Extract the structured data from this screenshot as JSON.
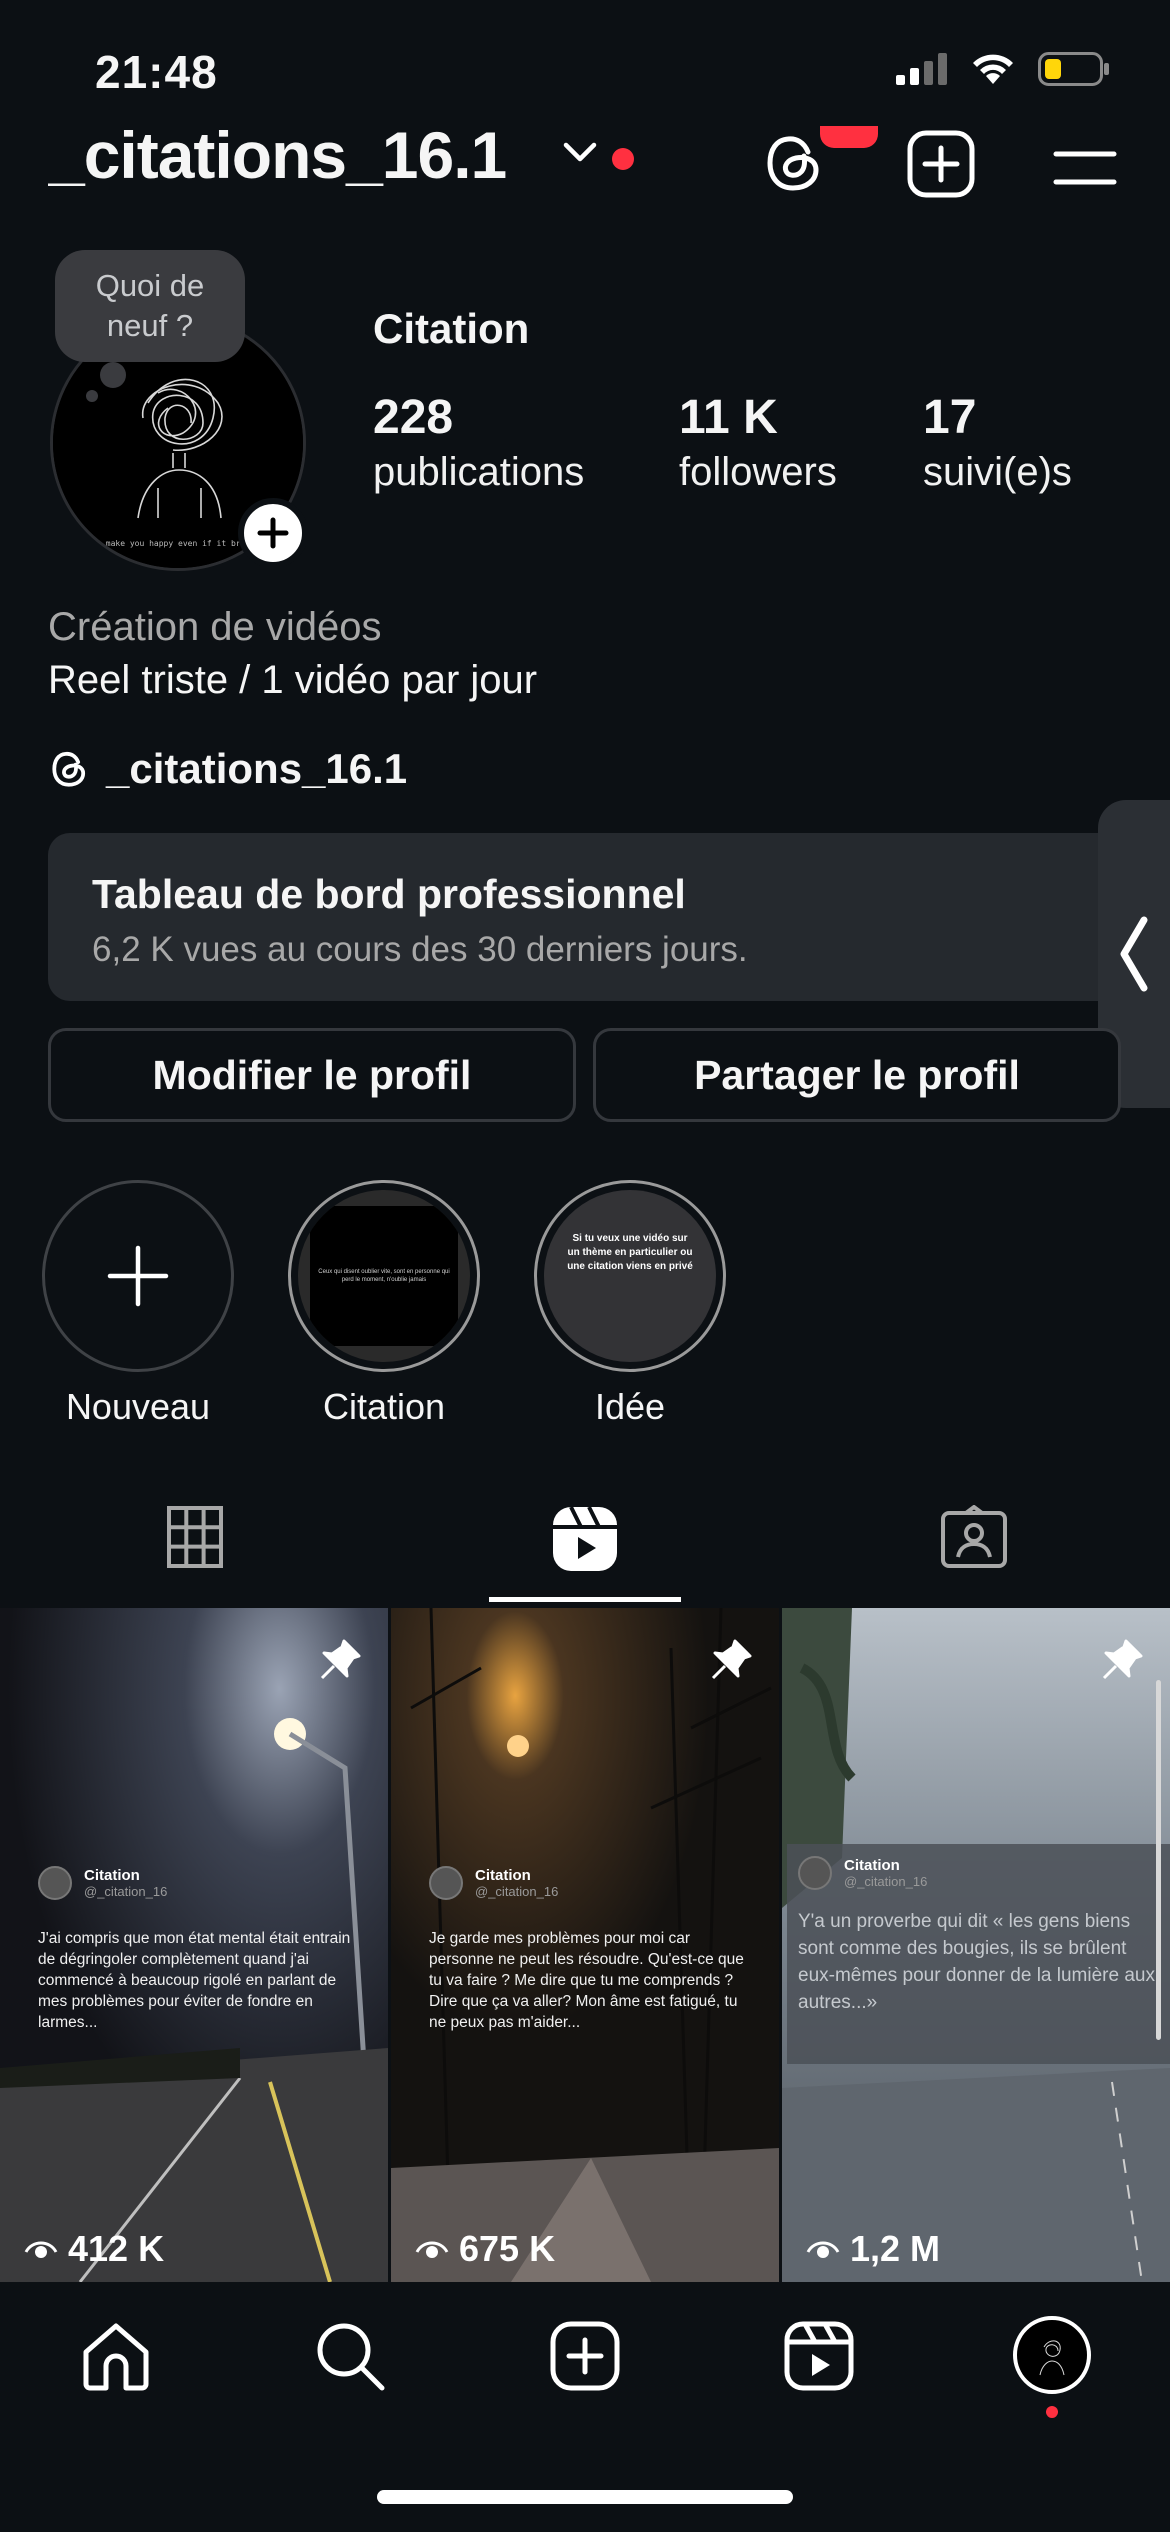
{
  "status_bar": {
    "time": "21:48"
  },
  "header": {
    "username": "_citations_16.1"
  },
  "profile": {
    "note": "Quoi de neuf ?",
    "display_name": "Citation",
    "stats": {
      "posts": {
        "value": "228",
        "label": "publications"
      },
      "followers": {
        "value": "11 K",
        "label": "followers"
      },
      "following": {
        "value": "17",
        "label": "suivi(e)s"
      }
    },
    "category": "Création de vidéos",
    "bio": "Reel triste / 1 vidéo par jour",
    "threads_handle": "_citations_16.1",
    "avatar_caption": "I'll make you happy even if it breaks me"
  },
  "dashboard": {
    "title": "Tableau de bord professionnel",
    "subtitle": "6,2 K vues au cours des 30 derniers jours."
  },
  "buttons": {
    "edit": "Modifier le profil",
    "share": "Partager le profil"
  },
  "highlights": [
    {
      "label": "Nouveau"
    },
    {
      "label": "Citation",
      "cover_text": "Ceux qui disent oublier vite, sont en personne qui perd le moment, n'oublie jamais"
    },
    {
      "label": "Idée",
      "cover_text": "Si tu veux une vidéo sur un thème en particulier ou une citation viens en privé"
    }
  ],
  "reels": [
    {
      "name": "Citation",
      "handle": "@_citation_16",
      "text": "J'ai compris que mon état mental était entrain de dégringoler complètement quand j'ai commencé à beaucoup rigolé en parlant de mes problèmes pour éviter de fondre en larmes...",
      "views": "412 K"
    },
    {
      "name": "Citation",
      "handle": "@_citation_16",
      "text": "Je garde mes problèmes pour moi car personne ne peut les résoudre. Qu'est-ce que tu va faire ? Me dire que tu me comprends ? Dire que ça va aller? Mon âme est fatigué, tu ne peux pas m'aider...",
      "views": "675 K"
    },
    {
      "name": "Citation",
      "handle": "@_citation_16",
      "text": "Y'a un proverbe qui dit « les gens biens sont comme des bougies, ils se brûlent eux-mêmes pour donner de la lumière aux autres...»",
      "views": "1,2 M"
    }
  ],
  "colors": {
    "background": "#0c1014",
    "accent_red": "#ff3040",
    "card": "#25292e",
    "muted_text": "#a8a8a8"
  },
  "icons": {
    "status": [
      "signal-icon",
      "wifi-icon",
      "battery-icon"
    ],
    "header": [
      "chevron-down-icon",
      "threads-icon",
      "add-icon",
      "menu-icon"
    ],
    "tabs": [
      "grid-icon",
      "reels-icon",
      "tagged-icon"
    ],
    "nav": [
      "home-icon",
      "search-icon",
      "create-icon",
      "reels-icon",
      "profile-avatar"
    ]
  }
}
